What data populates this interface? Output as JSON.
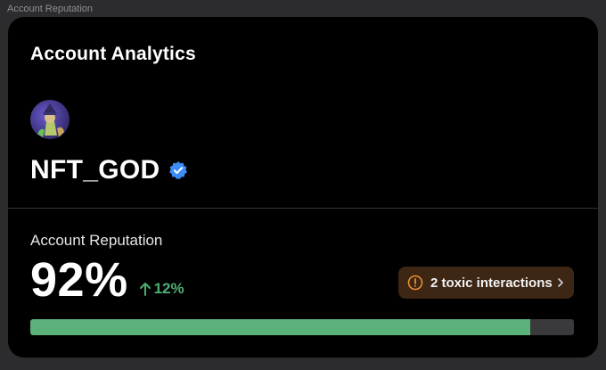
{
  "window": {
    "title": "Account Reputation"
  },
  "card": {
    "title": "Account Analytics",
    "username": "NFT_GOD",
    "verified": true
  },
  "reputation": {
    "label": "Account Reputation",
    "value_text": "92%",
    "value": 92,
    "change_text": "12%",
    "change_direction": "up"
  },
  "toxic": {
    "label": "2 toxic interactions"
  },
  "colors": {
    "background": "#000000",
    "accent_green": "#4caf72",
    "progress_fill": "#5bb17a",
    "verified_blue": "#3b8df7",
    "warning_orange": "#e8902f"
  },
  "icons": {
    "verified": "verified-badge-icon",
    "change": "arrow-up-icon",
    "warning": "warning-circle-icon",
    "chevron": "chevron-right-icon"
  }
}
